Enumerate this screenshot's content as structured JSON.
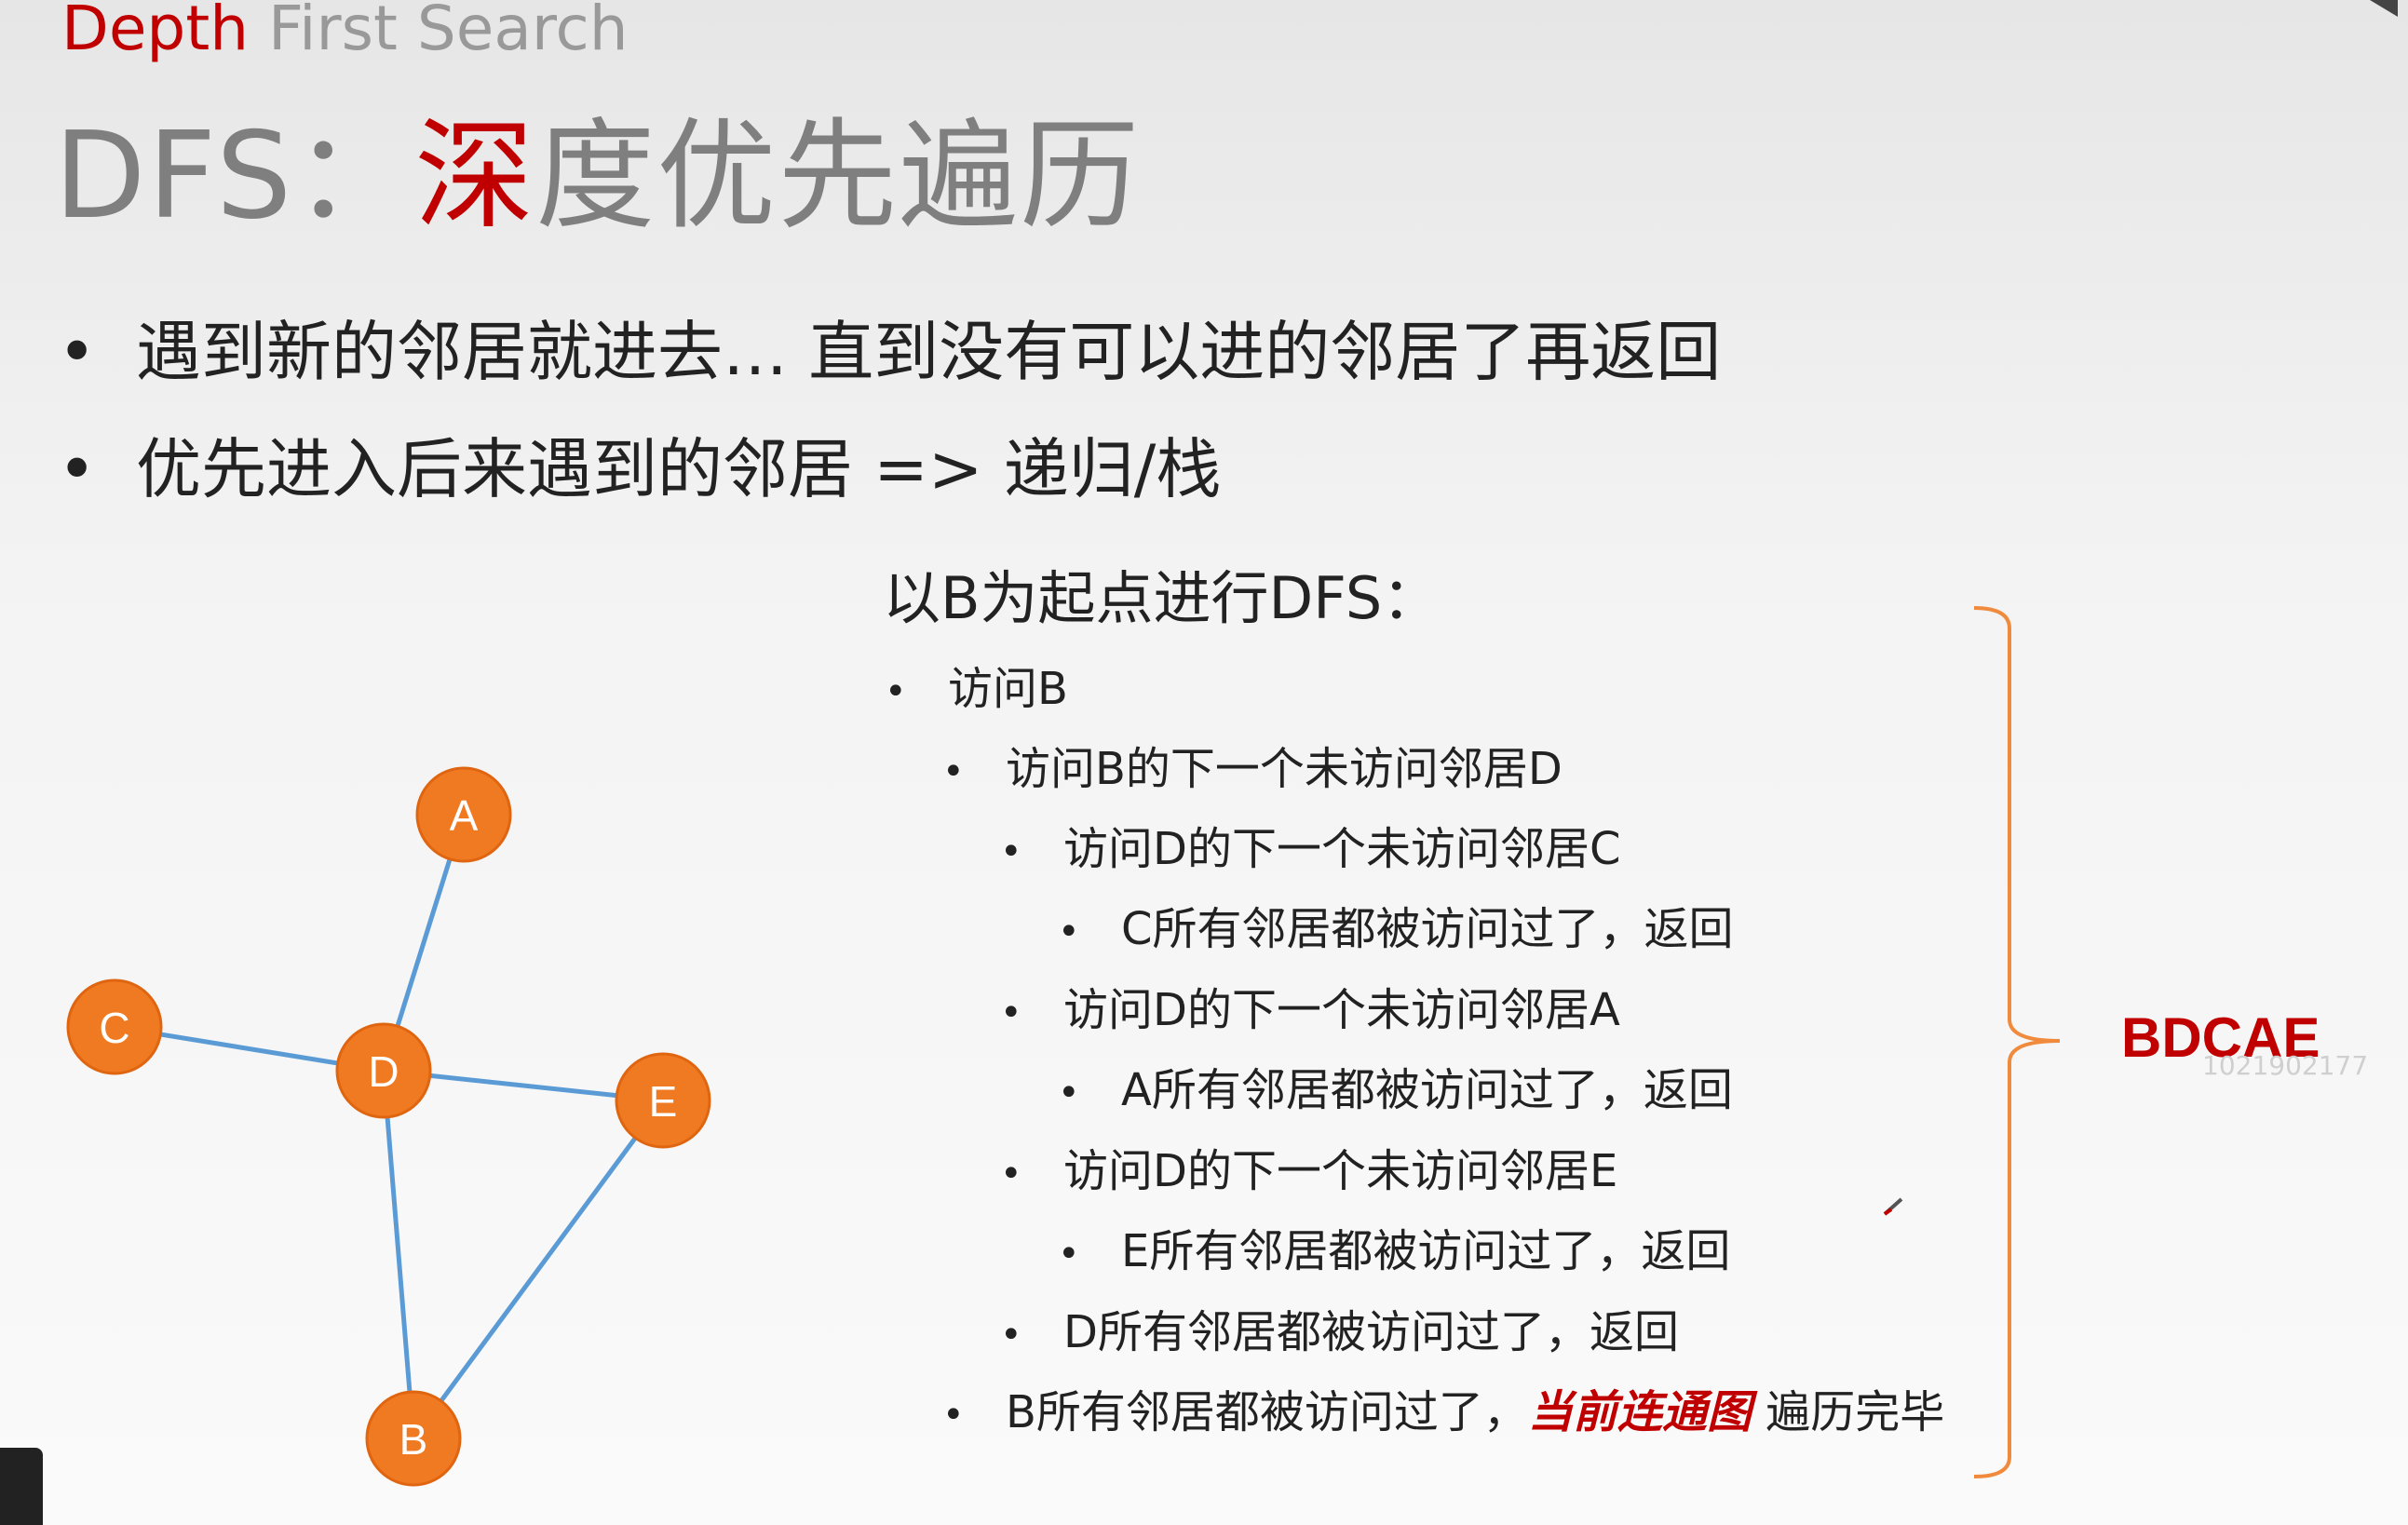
{
  "header": {
    "subtitle_part1": "Depth",
    "subtitle_part2": "First Search",
    "title_prefix": "DFS：",
    "title_accent": "深",
    "title_rest": "度优先遍历"
  },
  "bullets": [
    "遇到新的邻居就进去… 直到没有可以进的邻居了再返回",
    "优先进入后来遇到的邻居 => 递归/栈"
  ],
  "example": {
    "heading": "以B为起点进行DFS：",
    "steps": [
      {
        "level": 0,
        "text": "访问B"
      },
      {
        "level": 1,
        "text": "访问B的下一个未访问邻居D"
      },
      {
        "level": 2,
        "text": "访问D的下一个未访问邻居C"
      },
      {
        "level": 3,
        "text": "C所有邻居都被访问过了，返回"
      },
      {
        "level": 2,
        "text": "访问D的下一个未访问邻居A"
      },
      {
        "level": 3,
        "text": "A所有邻居都被访问过了，返回"
      },
      {
        "level": 2,
        "text": "访问D的下一个未访问邻居E"
      },
      {
        "level": 3,
        "text": "E所有邻居都被访问过了，返回"
      },
      {
        "level": 2,
        "text": "D所有邻居都被访问过了，返回"
      },
      {
        "level": 1,
        "text": "B所有邻居都被访问过了，",
        "highlight": "当前连通图",
        "suffix": " 遍历完毕"
      }
    ],
    "result": "BDCAE",
    "watermark": "1021902177"
  },
  "graph": {
    "nodes": [
      "A",
      "C",
      "D",
      "E",
      "B"
    ],
    "edges": [
      [
        "A",
        "D"
      ],
      [
        "C",
        "D"
      ],
      [
        "D",
        "E"
      ],
      [
        "D",
        "B"
      ],
      [
        "E",
        "B"
      ]
    ]
  },
  "colors": {
    "accent": "#c00000",
    "node_fill": "#f07a22",
    "edge": "#5b9bd5",
    "bracket": "#f08a3c"
  }
}
